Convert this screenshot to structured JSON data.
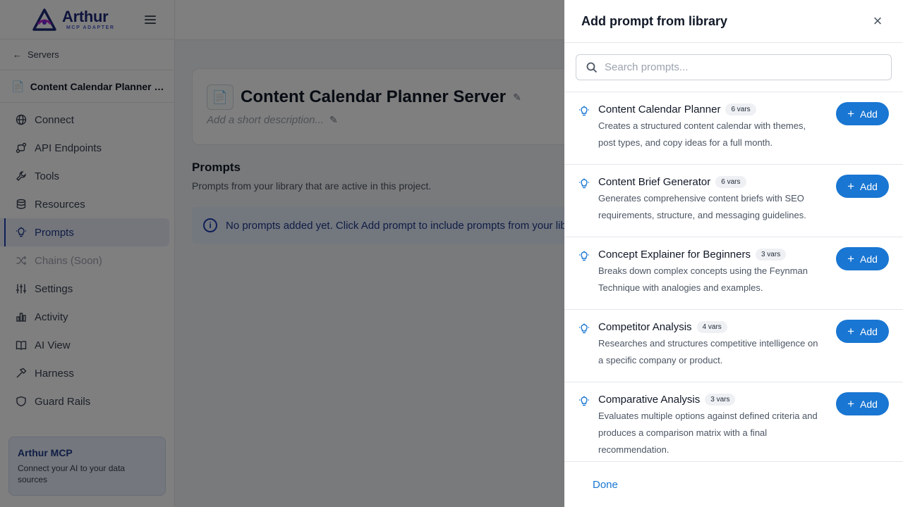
{
  "brand": {
    "name": "Arthur",
    "sub": "MCP ADAPTER"
  },
  "sidebar": {
    "back_label": "Servers",
    "server_name": "Content Calendar Planner Se...",
    "items": [
      {
        "label": "Connect",
        "icon": "globe-icon"
      },
      {
        "label": "API Endpoints",
        "icon": "route-icon"
      },
      {
        "label": "Tools",
        "icon": "wrench-icon"
      },
      {
        "label": "Resources",
        "icon": "database-icon"
      },
      {
        "label": "Prompts",
        "icon": "lightbulb-icon",
        "active": true
      },
      {
        "label": "Chains (Soon)",
        "icon": "shuffle-icon",
        "disabled": true
      },
      {
        "label": "Settings",
        "icon": "sliders-icon"
      },
      {
        "label": "Activity",
        "icon": "bar-chart-icon"
      },
      {
        "label": "AI View",
        "icon": "book-icon"
      },
      {
        "label": "Harness",
        "icon": "hammer-icon"
      },
      {
        "label": "Guard Rails",
        "icon": "shield-icon"
      }
    ],
    "promo": {
      "title": "Arthur MCP",
      "text": "Connect your AI to your data sources"
    }
  },
  "main": {
    "server_title": "Content Calendar Planner Server",
    "server_desc_placeholder": "Add a short description...",
    "prompts_title": "Prompts",
    "prompts_sub": "Prompts from your library that are active in this project.",
    "info_text": "No prompts added yet. Click Add prompt to include prompts from your library."
  },
  "drawer": {
    "title": "Add prompt from library",
    "search_placeholder": "Search prompts...",
    "add_label": "Add",
    "done_label": "Done",
    "items": [
      {
        "title": "Content Calendar Planner",
        "vars": "6 vars",
        "desc": "Creates a structured content calendar with themes, post types, and copy ideas for a full month."
      },
      {
        "title": "Content Brief Generator",
        "vars": "6 vars",
        "desc": "Generates comprehensive content briefs with SEO requirements, structure, and messaging guidelines."
      },
      {
        "title": "Concept Explainer for Beginners",
        "vars": "3 vars",
        "desc": "Breaks down complex concepts using the Feynman Technique with analogies and examples."
      },
      {
        "title": "Competitor Analysis",
        "vars": "4 vars",
        "desc": "Researches and structures competitive intelligence on a specific company or product."
      },
      {
        "title": "Comparative Analysis",
        "vars": "3 vars",
        "desc": "Evaluates multiple options against defined criteria and produces a comparison matrix with a final recommendation."
      }
    ]
  },
  "colors": {
    "accent": "#1976d2",
    "brand": "#1e2a78",
    "active_bg": "#e8edf9"
  }
}
